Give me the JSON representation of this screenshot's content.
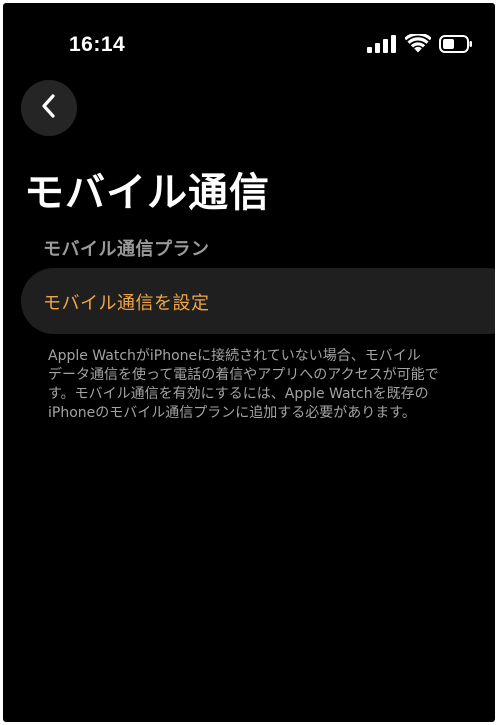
{
  "status_bar": {
    "time": "16:14",
    "icons": [
      "cellular-signal-icon",
      "wifi-icon",
      "battery-icon"
    ]
  },
  "nav": {
    "back_icon": "chevron-left-icon"
  },
  "page": {
    "title": "モバイル通信",
    "section_header": "モバイル通信プラン",
    "setup_row_label": "モバイル通信を設定",
    "description_lines": [
      "Apple WatchがiPhoneに接続されていない場合、モバイル",
      "データ通信を使って電話の着信やアプリへのアクセスが可能で",
      "す。モバイル通信を有効にするには、Apple Watchを既存の",
      "iPhoneのモバイル通信プランに追加する必要があります。"
    ]
  },
  "colors": {
    "background": "#000000",
    "accent": "#f0a646",
    "row_background": "#1f1f1f",
    "secondary_text": "#9a9a9a"
  }
}
